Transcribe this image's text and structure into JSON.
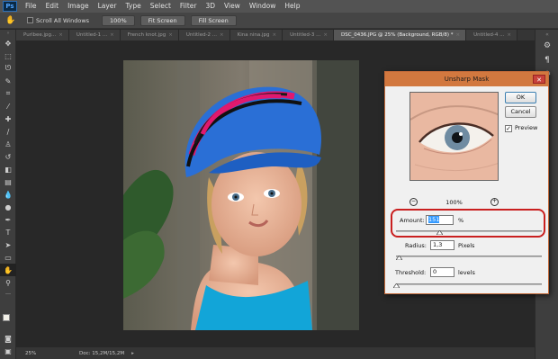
{
  "app": {
    "logo": "Ps"
  },
  "menu": [
    "File",
    "Edit",
    "Image",
    "Layer",
    "Type",
    "Select",
    "Filter",
    "3D",
    "View",
    "Window",
    "Help"
  ],
  "options": {
    "scroll_all_windows": "Scroll All Windows",
    "zoom_btn": "100%",
    "fit_screen": "Fit Screen",
    "fill_screen": "Fill Screen"
  },
  "tabs": [
    {
      "label": "Purlbee.jpg...",
      "active": false
    },
    {
      "label": "Untitled-1 ...",
      "active": false
    },
    {
      "label": "French knot.jpg",
      "active": false
    },
    {
      "label": "Untitled-2 ...",
      "active": false
    },
    {
      "label": "Kina nina.jpg",
      "active": false
    },
    {
      "label": "Untitled-3 ...",
      "active": false
    },
    {
      "label": "DSC_0436.JPG @ 25% (Background, RGB/8) *",
      "active": true
    },
    {
      "label": "Untitled-4 ...",
      "active": false
    }
  ],
  "status": {
    "zoom": "25%",
    "doc": "Doc: 15,2M/15,2M"
  },
  "dialog": {
    "title": "Unsharp Mask",
    "ok": "OK",
    "cancel": "Cancel",
    "preview_label": "Preview",
    "preview_checked": true,
    "zoom_level": "100%",
    "amount_label": "Amount:",
    "amount_value": "151",
    "amount_unit": "%",
    "radius_label": "Radius:",
    "radius_value": "1,3",
    "radius_unit": "Pixels",
    "threshold_label": "Threshold:",
    "threshold_value": "0",
    "threshold_unit": "levels",
    "amount_slider_fraction": 0.3,
    "radius_slider_fraction": 0.02,
    "threshold_slider_fraction": 0.0
  },
  "colors": {
    "highlight": "#c91f1f",
    "dialog_title": "#d2783f",
    "app_bg": "#282828"
  }
}
